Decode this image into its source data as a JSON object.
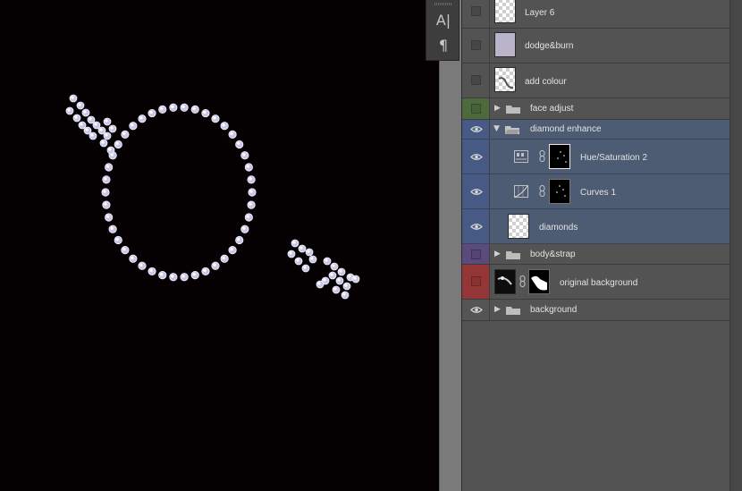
{
  "tool_strip": {
    "tools": [
      {
        "name": "character-panel",
        "glyph": "A|"
      },
      {
        "name": "paragraph-panel",
        "glyph": "¶"
      }
    ]
  },
  "layers": [
    {
      "label": "Layer 6",
      "visible": false
    },
    {
      "label": "dodge&burn",
      "visible": false
    },
    {
      "label": "add colour",
      "visible": false
    },
    {
      "label": "face adjust",
      "visible": false,
      "group": true,
      "expanded": false,
      "label_color": "#4c6a3c"
    },
    {
      "label": "diamond enhance",
      "visible": true,
      "group": true,
      "expanded": true,
      "selected": true
    },
    {
      "label": "Hue/Saturation 2",
      "visible": true,
      "adjustment": "hue-saturation",
      "selected": true
    },
    {
      "label": "Curves 1",
      "visible": true,
      "adjustment": "curves",
      "selected": true
    },
    {
      "label": "diamonds",
      "visible": true,
      "selected": true
    },
    {
      "label": "body&strap",
      "visible": false,
      "group": true,
      "expanded": false,
      "label_color": "#5b4a7e"
    },
    {
      "label": "original background",
      "visible": false,
      "label_color": "#943536"
    },
    {
      "label": "background",
      "visible": true,
      "group": true,
      "expanded": false
    }
  ],
  "colors": {
    "canvas_bg": "#050103",
    "panel_bg": "#535353",
    "selected_row": "#4d5b73",
    "text": "#e3e3e3"
  }
}
